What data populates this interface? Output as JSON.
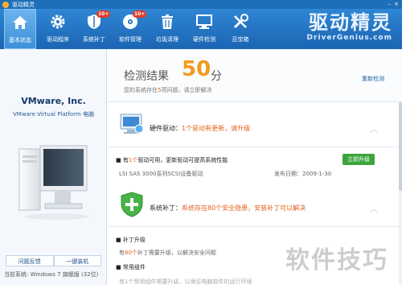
{
  "window": {
    "title": "驱动精灵"
  },
  "toolbar": {
    "items": [
      {
        "label": "基本状态",
        "icon": "home-icon",
        "active": true
      },
      {
        "label": "驱动程序",
        "icon": "gear-icon"
      },
      {
        "label": "系统补丁",
        "icon": "shield-icon",
        "badge": "10+"
      },
      {
        "label": "软件管理",
        "icon": "disc-icon",
        "badge": "10+"
      },
      {
        "label": "垃圾清理",
        "icon": "trash-icon"
      },
      {
        "label": "硬件检测",
        "icon": "monitor-icon"
      },
      {
        "label": "百宝箱",
        "icon": "tools-icon"
      }
    ],
    "brand_cn": "驱动精灵",
    "brand_en": "DriverGenius.com"
  },
  "left": {
    "vendor": "VMware, Inc.",
    "model": "VMware Virtual Platform 电脑",
    "feedback_label": "问题反馈",
    "install_label": "一键装机",
    "os_label": "当前系统:",
    "os_value": "Windows 7 旗舰版 (32位)"
  },
  "summary": {
    "heading": "检测结果",
    "score": "50",
    "unit": "分",
    "desc_prefix": "您的系统存在",
    "issue_count": "5",
    "desc_suffix": "项问题，请立即解决",
    "recheck_label": "重新检测"
  },
  "driver_section": {
    "title": "硬件驱动：",
    "status": "1个驱动有更新，请升级",
    "row_prefix": "有",
    "row_count": "1个",
    "row_suffix": "驱动可用，更新驱动可提高系统性能",
    "upgrade_label": "立即升级",
    "device_name": "LSI SAS 3000系列SCSI设备驱动",
    "release_label": "发布日期：2009-1-30"
  },
  "patch_section": {
    "title": "系统补丁：",
    "status": "系统存在80个安全隐患，安装补丁可以解决",
    "group_title": "补丁升级",
    "group_row_prefix": "有",
    "group_row_count": "80个",
    "group_row_suffix": "补丁需要升级，以解决安全问题",
    "common_title": "常用组件",
    "common_row": "有1个常用组件需要升级，以保证电脑软件的运行环境"
  },
  "watermark": "软件技巧",
  "colors": {
    "toolbar": "#2f86d4",
    "accent_orange": "#f39a1e",
    "warning": "#e2621b",
    "upgrade_green": "#3aa53a"
  }
}
